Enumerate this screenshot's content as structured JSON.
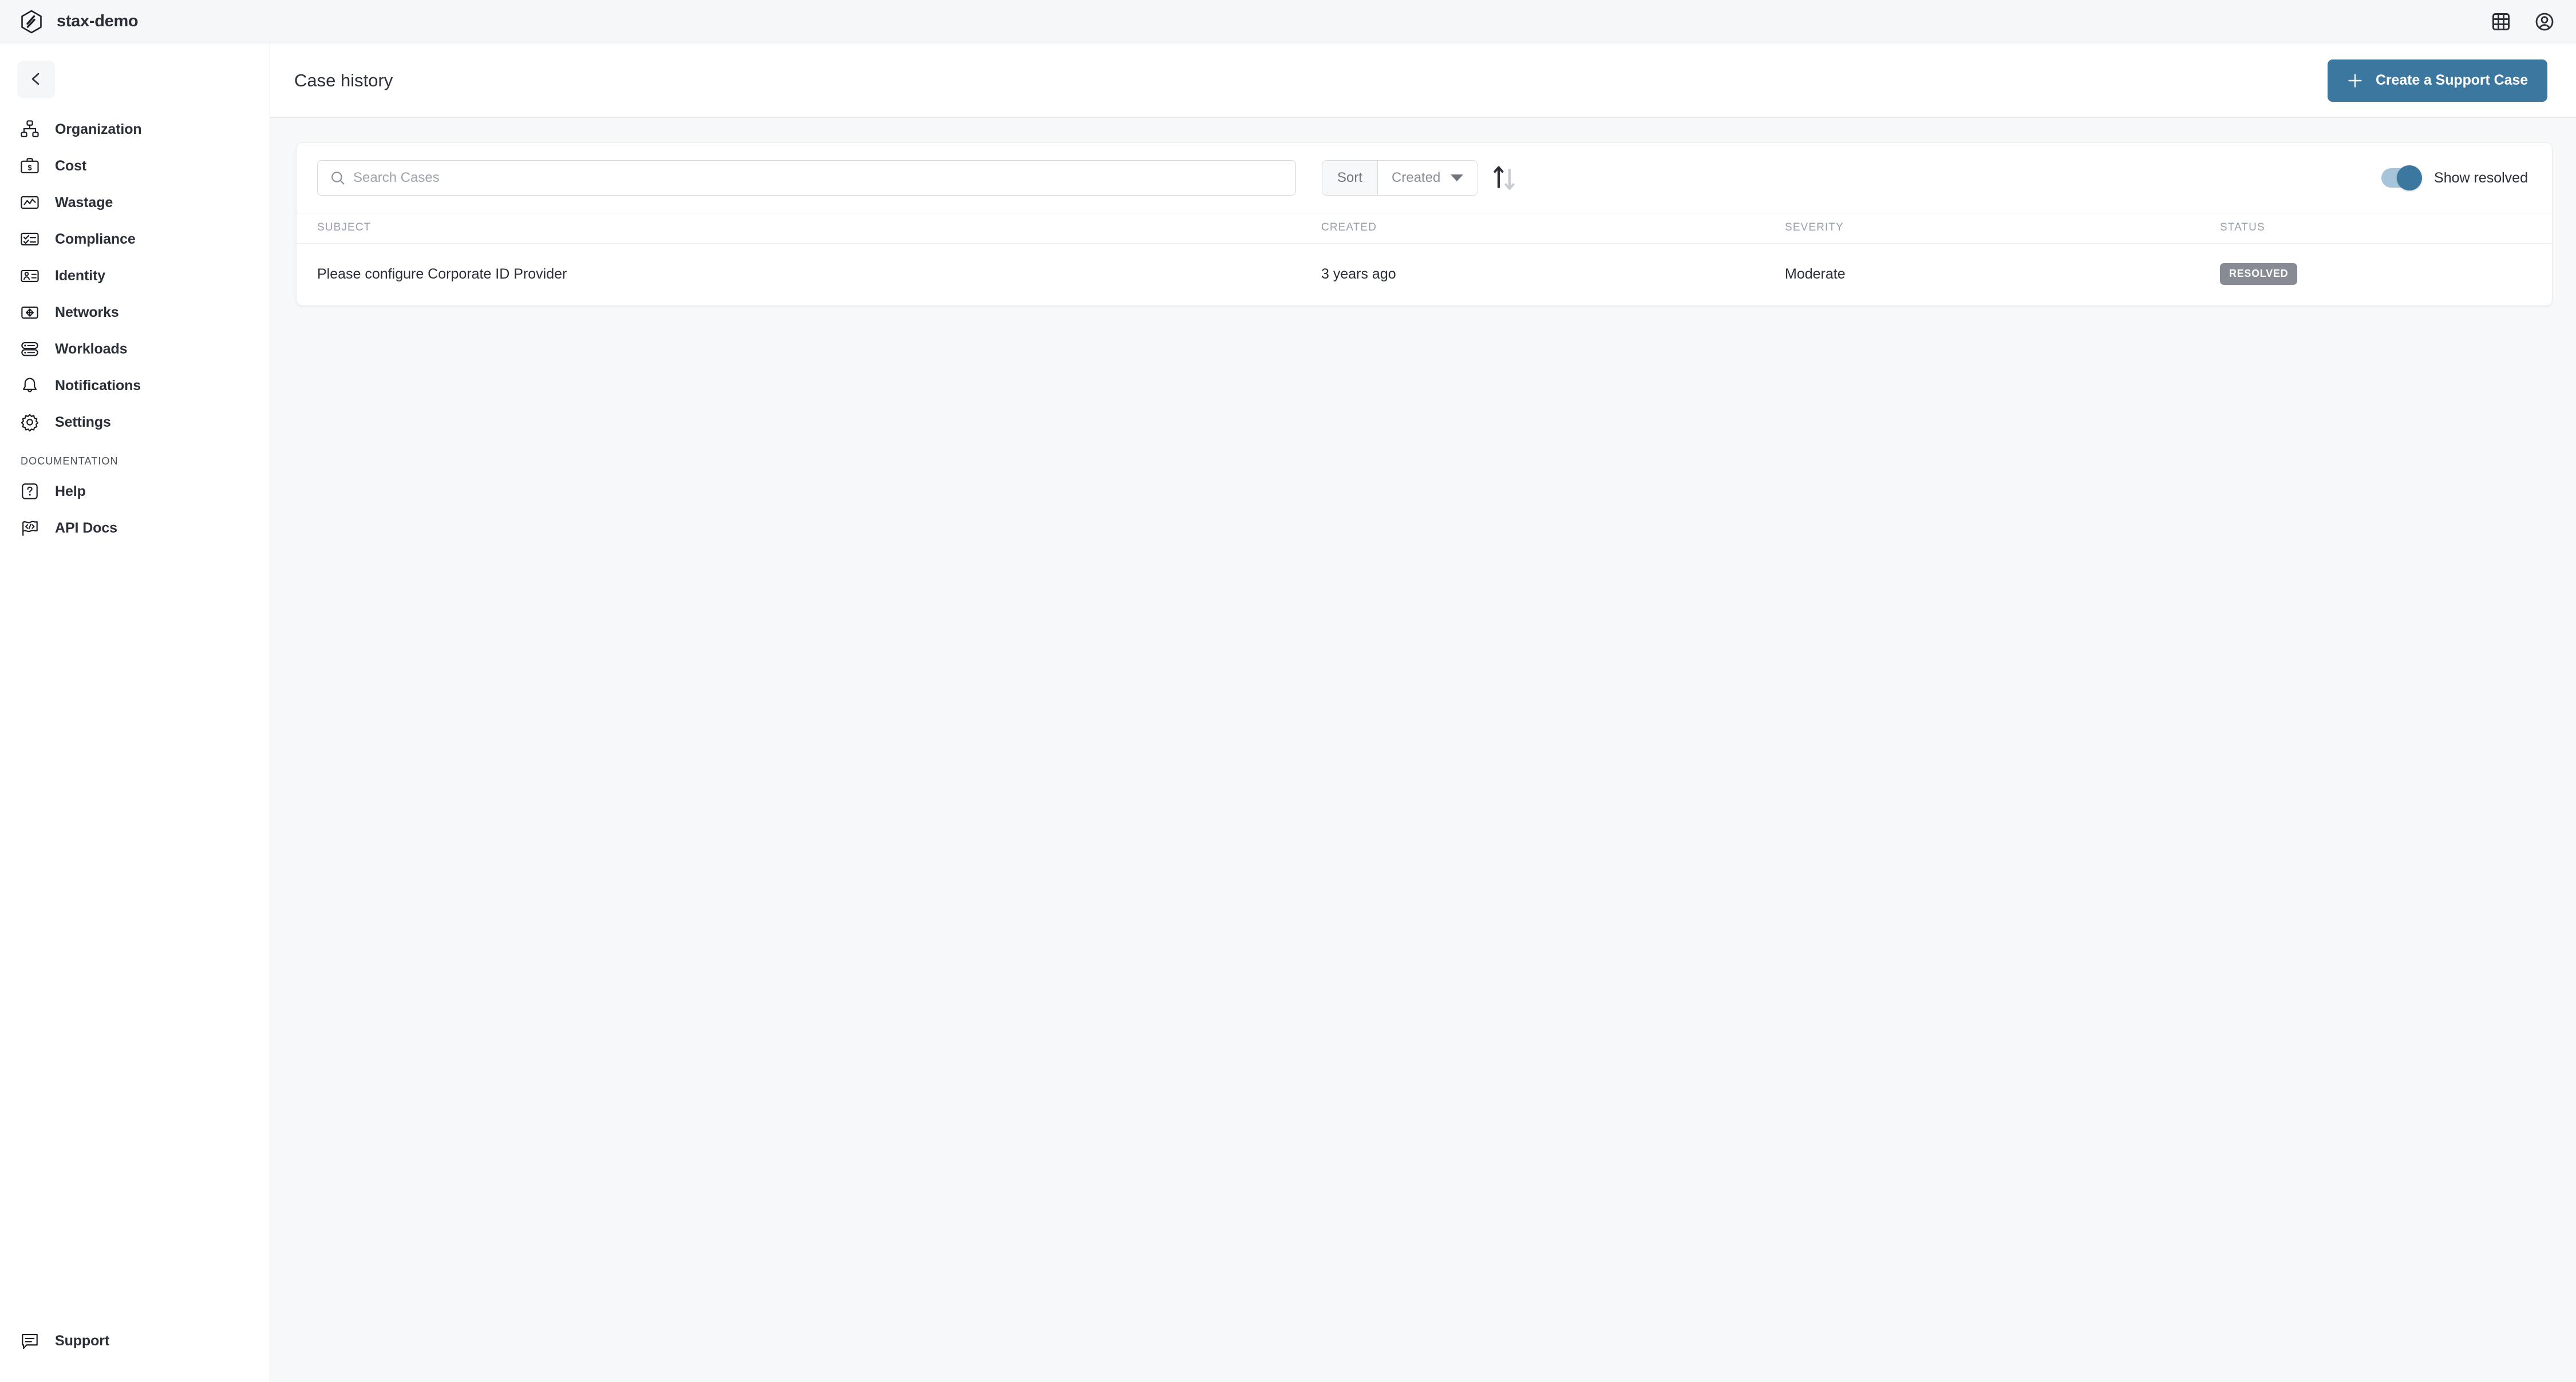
{
  "topbar": {
    "brand_name": "stax-demo",
    "logo_icon": "hexagon-stax-logo",
    "apps_icon": "grid-apps-icon",
    "account_icon": "user-account-circle-icon"
  },
  "sidebar": {
    "collapse_icon": "chevron-left-icon",
    "items": [
      {
        "label": "Organization",
        "icon": "org-chart-icon"
      },
      {
        "label": "Cost",
        "icon": "briefcase-dollar-icon"
      },
      {
        "label": "Wastage",
        "icon": "chart-line-icon"
      },
      {
        "label": "Compliance",
        "icon": "checklist-icon"
      },
      {
        "label": "Identity",
        "icon": "id-card-icon"
      },
      {
        "label": "Networks",
        "icon": "arrows-expand-icon"
      },
      {
        "label": "Workloads",
        "icon": "server-stack-icon"
      },
      {
        "label": "Notifications",
        "icon": "bell-icon"
      },
      {
        "label": "Settings",
        "icon": "gear-icon"
      }
    ],
    "section_label": "DOCUMENTATION",
    "doc_items": [
      {
        "label": "Help",
        "icon": "question-square-icon"
      },
      {
        "label": "API Docs",
        "icon": "flag-code-icon"
      }
    ],
    "bottom_items": [
      {
        "label": "Support",
        "icon": "chat-bubble-icon"
      }
    ]
  },
  "page": {
    "title": "Case history",
    "create_button": {
      "label": "Create a Support Case",
      "icon": "plus-icon"
    }
  },
  "toolbar": {
    "search": {
      "placeholder": "Search Cases",
      "value": "",
      "icon": "search-icon"
    },
    "sort": {
      "label": "Sort",
      "selected": "Created",
      "caret_icon": "chevron-down-icon",
      "direction_icon": "sort-ascending-arrows-icon",
      "direction": "ascending"
    },
    "show_resolved": {
      "label": "Show resolved",
      "enabled": true
    }
  },
  "table": {
    "columns": [
      "SUBJECT",
      "CREATED",
      "SEVERITY",
      "STATUS"
    ],
    "rows": [
      {
        "subject": "Please configure Corporate ID Provider",
        "created": "3 years ago",
        "severity": "Moderate",
        "status": "RESOLVED"
      }
    ]
  },
  "colors": {
    "accent": "#3b779f",
    "toggle_track": "#a6c5da",
    "badge_resolved": "#868b94",
    "topbar_bg": "#f6f7f9",
    "main_bg": "#f7f8f9",
    "text": "#2b2f38"
  }
}
